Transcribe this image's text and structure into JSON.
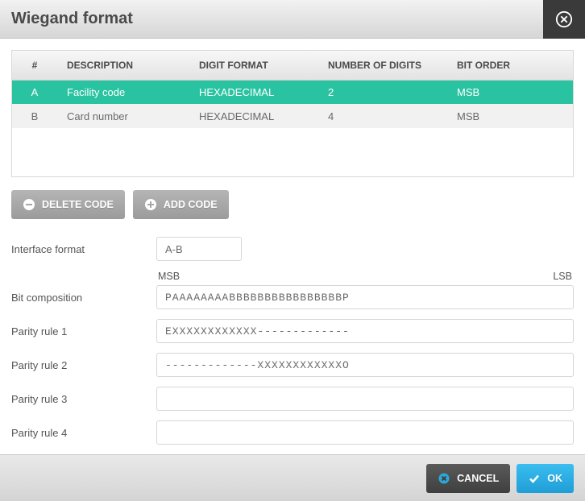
{
  "title": "Wiegand format",
  "table": {
    "headers": [
      "#",
      "DESCRIPTION",
      "DIGIT FORMAT",
      "NUMBER OF DIGITS",
      "BIT ORDER"
    ],
    "rows": [
      {
        "idx": "A",
        "description": "Facility code",
        "digit_format": "HEXADECIMAL",
        "num_digits": "2",
        "bit_order": "MSB",
        "selected": true
      },
      {
        "idx": "B",
        "description": "Card number",
        "digit_format": "HEXADECIMAL",
        "num_digits": "4",
        "bit_order": "MSB",
        "selected": false
      }
    ]
  },
  "buttons": {
    "delete_code": "DELETE CODE",
    "add_code": "ADD CODE",
    "cancel": "CANCEL",
    "ok": "OK"
  },
  "labels": {
    "interface_format": "Interface format",
    "bit_composition": "Bit composition",
    "parity1": "Parity rule 1",
    "parity2": "Parity rule 2",
    "parity3": "Parity rule 3",
    "parity4": "Parity rule 4",
    "msb": "MSB",
    "lsb": "LSB"
  },
  "fields": {
    "interface_format": "A-B",
    "bit_composition": "PAAAAAAAABBBBBBBBBBBBBBBBP",
    "parity1": "EXXXXXXXXXXXX-------------",
    "parity2": "-------------XXXXXXXXXXXXO",
    "parity3": "",
    "parity4": ""
  }
}
